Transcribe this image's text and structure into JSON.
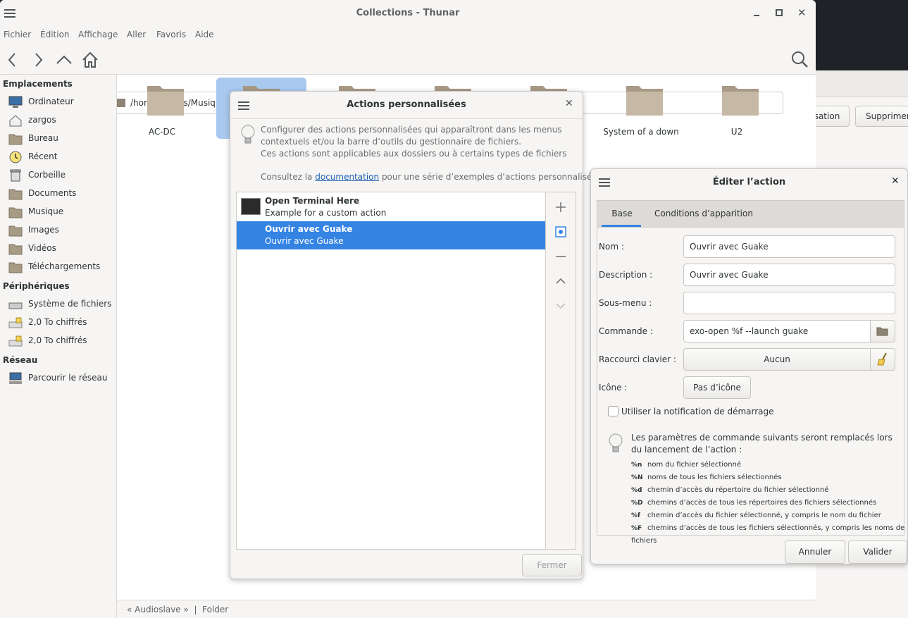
{
  "back_window": {
    "btn_partial": "sation",
    "btn_delete": "Supprimer"
  },
  "thunar": {
    "title": "Collections - Thunar",
    "menu": [
      "Fichier",
      "Édition",
      "Affichage",
      "Aller",
      "Favoris",
      "Aide"
    ],
    "path": "/home/zargos/Musique/Collections/",
    "sidebar": {
      "sections": [
        {
          "title": "Emplacements",
          "items": [
            {
              "label": "Ordinateur",
              "icon": "computer-icon"
            },
            {
              "label": "zargos",
              "icon": "home-icon"
            },
            {
              "label": "Bureau",
              "icon": "folder-icon"
            },
            {
              "label": "Récent",
              "icon": "clock-icon"
            },
            {
              "label": "Corbeille",
              "icon": "trash-icon"
            },
            {
              "label": "Documents",
              "icon": "folder-icon"
            },
            {
              "label": "Musique",
              "icon": "folder-icon"
            },
            {
              "label": "Images",
              "icon": "folder-icon"
            },
            {
              "label": "Vidéos",
              "icon": "folder-icon"
            },
            {
              "label": "Téléchargements",
              "icon": "folder-icon"
            }
          ]
        },
        {
          "title": "Périphériques",
          "items": [
            {
              "label": "Système de fichiers",
              "icon": "drive-icon"
            },
            {
              "label": "2,0 To chiffrés",
              "icon": "drive-icon"
            },
            {
              "label": "2,0 To chiffrés",
              "icon": "drive-icon"
            }
          ]
        },
        {
          "title": "Réseau",
          "items": [
            {
              "label": "Parcourir le réseau",
              "icon": "network-icon"
            }
          ]
        }
      ]
    },
    "folders": [
      "AC-DC",
      "",
      "",
      "",
      "",
      "System of a down",
      "U2"
    ],
    "status": "« Audioslave »  |  Folder"
  },
  "actions_dialog": {
    "title": "Actions personnalisées",
    "info_line1": "Configurer des actions personnalisées qui apparaîtront dans les menus",
    "info_line2": "contextuels et/ou la barre d’outils du gestionnaire de fichiers.",
    "info_line3": "Ces actions sont applicables aux dossiers ou à certains types de fichiers",
    "consult_prefix": "Consultez la ",
    "consult_link": "documentation",
    "consult_suffix": " pour une série d’exemples d’actions personnalisées.",
    "list": [
      {
        "name": "Open Terminal Here",
        "desc": "Example for a custom action"
      },
      {
        "name": "Ouvrir avec Guake",
        "desc": "Ouvrir avec Guake"
      }
    ],
    "close_btn": "Fermer"
  },
  "edit_dialog": {
    "title": "Éditer l’action",
    "tabs": [
      "Base",
      "Conditions d’apparition"
    ],
    "labels": {
      "name": "Nom :",
      "desc": "Description :",
      "submenu": "Sous-menu :",
      "command": "Commande :",
      "shortcut": "Raccourci clavier :",
      "icon": "Icône :"
    },
    "values": {
      "name": "Ouvrir avec Guake",
      "desc": "Ouvrir avec Guake",
      "submenu": "",
      "command": "exo-open %f --launch guake",
      "shortcut": "Aucun",
      "icon": "Pas d’icône"
    },
    "startup_notify": "Utiliser la notification de démarrage",
    "params_intro": "Les paramètres de commande suivants seront remplacés lors du lancement de l’action :",
    "params": [
      {
        "code": "%n",
        "text": "nom du fichier sélectionné"
      },
      {
        "code": "%N",
        "text": "noms de tous les fichiers sélectionnés"
      },
      {
        "code": "%d",
        "text": "chemin d’accès du répertoire du fichier sélectionné"
      },
      {
        "code": "%D",
        "text": "chemins d’accès de tous les répertoires des fichiers sélectionnés"
      },
      {
        "code": "%f",
        "text": "chemin d’accès du fichier sélectionné, y compris le nom du fichier"
      },
      {
        "code": "%F",
        "text": "chemins d’accès de tous les fichiers sélectionnés, y compris les noms de fichiers"
      }
    ],
    "cancel": "Annuler",
    "ok": "Valider"
  }
}
